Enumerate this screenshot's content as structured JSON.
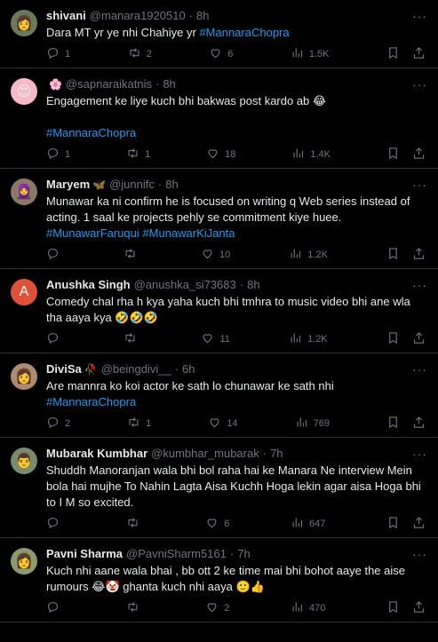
{
  "tweets": [
    {
      "name": "shivani",
      "badge": "",
      "handle": "@manara1920510",
      "time": "8h",
      "avatar": {
        "bg": "#6b7a5a",
        "glyph": "",
        "emoji": "👩"
      },
      "text": [
        "Dara MT yr ye nhi Chahiye yr "
      ],
      "hashtags": [
        "#MannaraChopra"
      ],
      "counts": {
        "replies": "1",
        "retweets": "2",
        "likes": "6",
        "views": "1.5K"
      }
    },
    {
      "name": "",
      "badge": "🌸",
      "handle": "@sapnaraikatnis",
      "time": "8h",
      "avatar": {
        "bg": "#f6b9c8",
        "glyph": "",
        "emoji": "😍"
      },
      "text": [
        "Engagement ke liye kuch bhi bakwas post kardo ab 😂"
      ],
      "hashtags": [
        "#MannaraChopra"
      ],
      "counts": {
        "replies": "1",
        "retweets": "1",
        "likes": "18",
        "views": "1.4K"
      }
    },
    {
      "name": "Maryem",
      "badge": "🦋",
      "handle": "@junnifc",
      "time": "8h",
      "avatar": {
        "bg": "#8c7864",
        "glyph": "",
        "emoji": "🧕"
      },
      "text": [
        "Munawar ka ni confirm he is focused on writing q Web series instead of acting. 1 saal ke projects pehly se commitment kiye huee."
      ],
      "hashtags": [
        "#MunawarFaruqui",
        "#MunawarKiJanta"
      ],
      "counts": {
        "replies": "",
        "retweets": "",
        "likes": "10",
        "views": "1.2K"
      }
    },
    {
      "name": "Anushka Singh",
      "badge": "",
      "handle": "@anushka_si73683",
      "time": "8h",
      "avatar": {
        "bg": "#e0513a",
        "glyph": "A",
        "emoji": ""
      },
      "text": [
        "Comedy chal rha h kya yaha kuch bhi tmhra to music video bhi ane wla tha aaya kya 🤣🤣🤣"
      ],
      "hashtags": [],
      "counts": {
        "replies": "",
        "retweets": "",
        "likes": "11",
        "views": "1.2K"
      }
    },
    {
      "name": "DiviSa",
      "badge": "🥀",
      "handle": "@beingdivi__",
      "time": "6h",
      "avatar": {
        "bg": "#b08a70",
        "glyph": "",
        "emoji": "👩"
      },
      "text": [
        "Are mannra ko koi actor ke sath lo  chunawar ke sath nhi"
      ],
      "hashtags": [
        "#MannaraChopra"
      ],
      "counts": {
        "replies": "2",
        "retweets": "1",
        "likes": "14",
        "views": "769"
      }
    },
    {
      "name": "Mubarak Kumbhar",
      "badge": "",
      "handle": "@kumbhar_mubarak",
      "time": "7h",
      "avatar": {
        "bg": "#7a8a6a",
        "glyph": "",
        "emoji": "👨"
      },
      "text": [
        "Shuddh Manoranjan wala bhi bol raha hai ke Manara Ne interview Mein bola hai mujhe To Nahin Lagta Aisa Kuchh Hoga lekin agar aisa Hoga bhi to I M so excited."
      ],
      "hashtags": [],
      "counts": {
        "replies": "",
        "retweets": "",
        "likes": "6",
        "views": "647"
      }
    },
    {
      "name": "Pavni Sharma",
      "badge": "",
      "handle": "@PavniSharm5161",
      "time": "7h",
      "avatar": {
        "bg": "#8e9a6e",
        "glyph": "",
        "emoji": "👩"
      },
      "text": [
        "Kuch nhi aane wala bhai , bb ott 2 ke time mai bhi bohot aaye the aise rumours 😂🤡 ghanta kuch nhi aaya 🙂👍"
      ],
      "hashtags": [],
      "counts": {
        "replies": "",
        "retweets": "",
        "likes": "2",
        "views": "470"
      }
    }
  ],
  "icons": {
    "reply": "reply-icon",
    "retweet": "retweet-icon",
    "like": "heart-icon",
    "views": "views-icon",
    "bookmark": "bookmark-icon",
    "share": "share-icon",
    "more": "more-icon"
  },
  "colors": {
    "background": "#000000",
    "text": "#e7e9ea",
    "muted": "#71767b",
    "link": "#1d9bf0",
    "divider": "#2f3336"
  },
  "more_glyph": "···"
}
